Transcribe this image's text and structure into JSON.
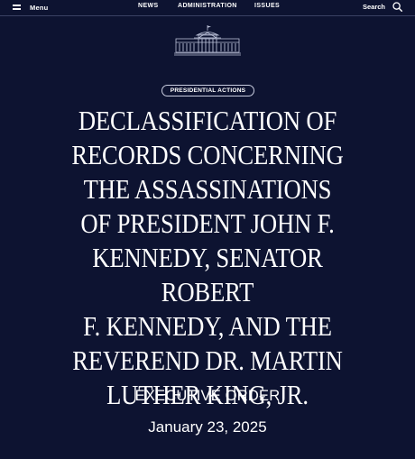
{
  "header": {
    "menu_label": "Menu",
    "nav": [
      "NEWS",
      "ADMINISTRATION",
      "ISSUES"
    ],
    "search_label": "Search"
  },
  "badge": "PRESIDENTIAL ACTIONS",
  "title_lines": [
    "DECLASSIFICATION OF",
    "RECORDS CONCERNING",
    "THE ASSASSINATIONS",
    "OF PRESIDENT JOHN F.",
    "KENNEDY, SENATOR ROBERT",
    "F. KENNEDY, AND THE",
    "REVEREND DR. MARTIN",
    "LUTHER KING, JR."
  ],
  "subtitle": "EXECUTIVE ORDER",
  "date": "January 23, 2025",
  "colors": {
    "background": "#0d1331",
    "text": "#ffffff",
    "divider": "#3a4163"
  }
}
